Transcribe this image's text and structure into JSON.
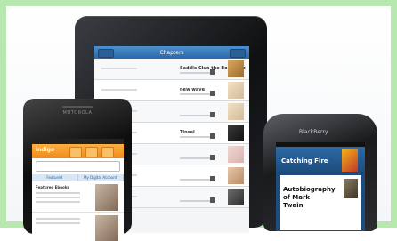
{
  "tablet": {
    "nav_title": "Chapters",
    "rows": [
      {
        "small": "",
        "title": "Saddle Club the Bookshop"
      },
      {
        "small": "",
        "title": "new wave"
      },
      {
        "small": "",
        "title": ""
      },
      {
        "small": "",
        "title": "Tinsel"
      },
      {
        "small": "",
        "title": ""
      },
      {
        "small": "",
        "title": ""
      },
      {
        "small": "",
        "title": ""
      },
      {
        "small": "",
        "title": ""
      }
    ]
  },
  "android": {
    "brand": "MOTOROLA",
    "logo": "indigo",
    "tabs": [
      "Featured",
      "My Digital Account"
    ],
    "items": [
      {
        "title": "Featured Ebooks",
        "subtitle": ""
      },
      {
        "title": "",
        "subtitle": ""
      }
    ]
  },
  "blackberry": {
    "logo": "BlackBerry",
    "banner_small": "",
    "banner_title": "Catching Fire",
    "list_small": "",
    "list_line1": "Autobiography",
    "list_line2": "of Mark",
    "list_line3": "Twain"
  },
  "colors": {
    "border_green": "#b6e8b0",
    "tablet_bar_blue": "#2a68a8",
    "android_orange": "#f0891c",
    "blackberry_blue": "#1e4d7d"
  }
}
